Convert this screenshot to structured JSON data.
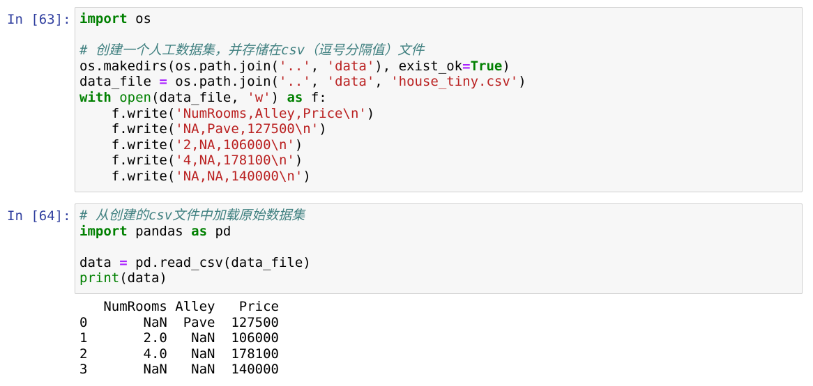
{
  "cell1": {
    "prompt": "In [63]:",
    "lines": [
      [
        {
          "t": "import",
          "c": "kw"
        },
        {
          "t": " os",
          "c": "plain"
        }
      ],
      [],
      [
        {
          "t": "# 创建一个人工数据集，并存储在csv（逗号分隔值）文件",
          "c": "cm"
        }
      ],
      [
        {
          "t": "os.makedirs(os.path.join(",
          "c": "plain"
        },
        {
          "t": "'..'",
          "c": "str"
        },
        {
          "t": ", ",
          "c": "plain"
        },
        {
          "t": "'data'",
          "c": "str"
        },
        {
          "t": "), exist_ok",
          "c": "plain"
        },
        {
          "t": "=",
          "c": "op"
        },
        {
          "t": "True",
          "c": "kw"
        },
        {
          "t": ")",
          "c": "plain"
        }
      ],
      [
        {
          "t": "data_file ",
          "c": "plain"
        },
        {
          "t": "=",
          "c": "op"
        },
        {
          "t": " os.path.join(",
          "c": "plain"
        },
        {
          "t": "'..'",
          "c": "str"
        },
        {
          "t": ", ",
          "c": "plain"
        },
        {
          "t": "'data'",
          "c": "str"
        },
        {
          "t": ", ",
          "c": "plain"
        },
        {
          "t": "'house_tiny.csv'",
          "c": "str"
        },
        {
          "t": ")",
          "c": "plain"
        }
      ],
      [
        {
          "t": "with",
          "c": "kw"
        },
        {
          "t": " ",
          "c": "plain"
        },
        {
          "t": "open",
          "c": "bi"
        },
        {
          "t": "(data_file, ",
          "c": "plain"
        },
        {
          "t": "'w'",
          "c": "str"
        },
        {
          "t": ") ",
          "c": "plain"
        },
        {
          "t": "as",
          "c": "kw"
        },
        {
          "t": " f:",
          "c": "plain"
        }
      ],
      [
        {
          "t": "    f.write(",
          "c": "plain"
        },
        {
          "t": "'NumRooms,Alley,Price\\n'",
          "c": "str"
        },
        {
          "t": ")",
          "c": "plain"
        }
      ],
      [
        {
          "t": "    f.write(",
          "c": "plain"
        },
        {
          "t": "'NA,Pave,127500\\n'",
          "c": "str"
        },
        {
          "t": ")",
          "c": "plain"
        }
      ],
      [
        {
          "t": "    f.write(",
          "c": "plain"
        },
        {
          "t": "'2,NA,106000\\n'",
          "c": "str"
        },
        {
          "t": ")",
          "c": "plain"
        }
      ],
      [
        {
          "t": "    f.write(",
          "c": "plain"
        },
        {
          "t": "'4,NA,178100\\n'",
          "c": "str"
        },
        {
          "t": ")",
          "c": "plain"
        }
      ],
      [
        {
          "t": "    f.write(",
          "c": "plain"
        },
        {
          "t": "'NA,NA,140000\\n'",
          "c": "str"
        },
        {
          "t": ")",
          "c": "plain"
        }
      ]
    ]
  },
  "cell2": {
    "prompt": "In [64]:",
    "lines": [
      [
        {
          "t": "# 从创建的csv文件中加载原始数据集",
          "c": "cm"
        }
      ],
      [
        {
          "t": "import",
          "c": "kw"
        },
        {
          "t": " pandas ",
          "c": "plain"
        },
        {
          "t": "as",
          "c": "kw"
        },
        {
          "t": " pd",
          "c": "plain"
        }
      ],
      [],
      [
        {
          "t": "data ",
          "c": "plain"
        },
        {
          "t": "=",
          "c": "op"
        },
        {
          "t": " pd.read_csv(data_file)",
          "c": "plain"
        }
      ],
      [
        {
          "t": "print",
          "c": "bi"
        },
        {
          "t": "(data)",
          "c": "plain"
        }
      ]
    ],
    "output_lines": [
      "   NumRooms Alley   Price",
      "0       NaN  Pave  127500",
      "1       2.0   NaN  106000",
      "2       4.0   NaN  178100",
      "3       NaN   NaN  140000"
    ]
  }
}
